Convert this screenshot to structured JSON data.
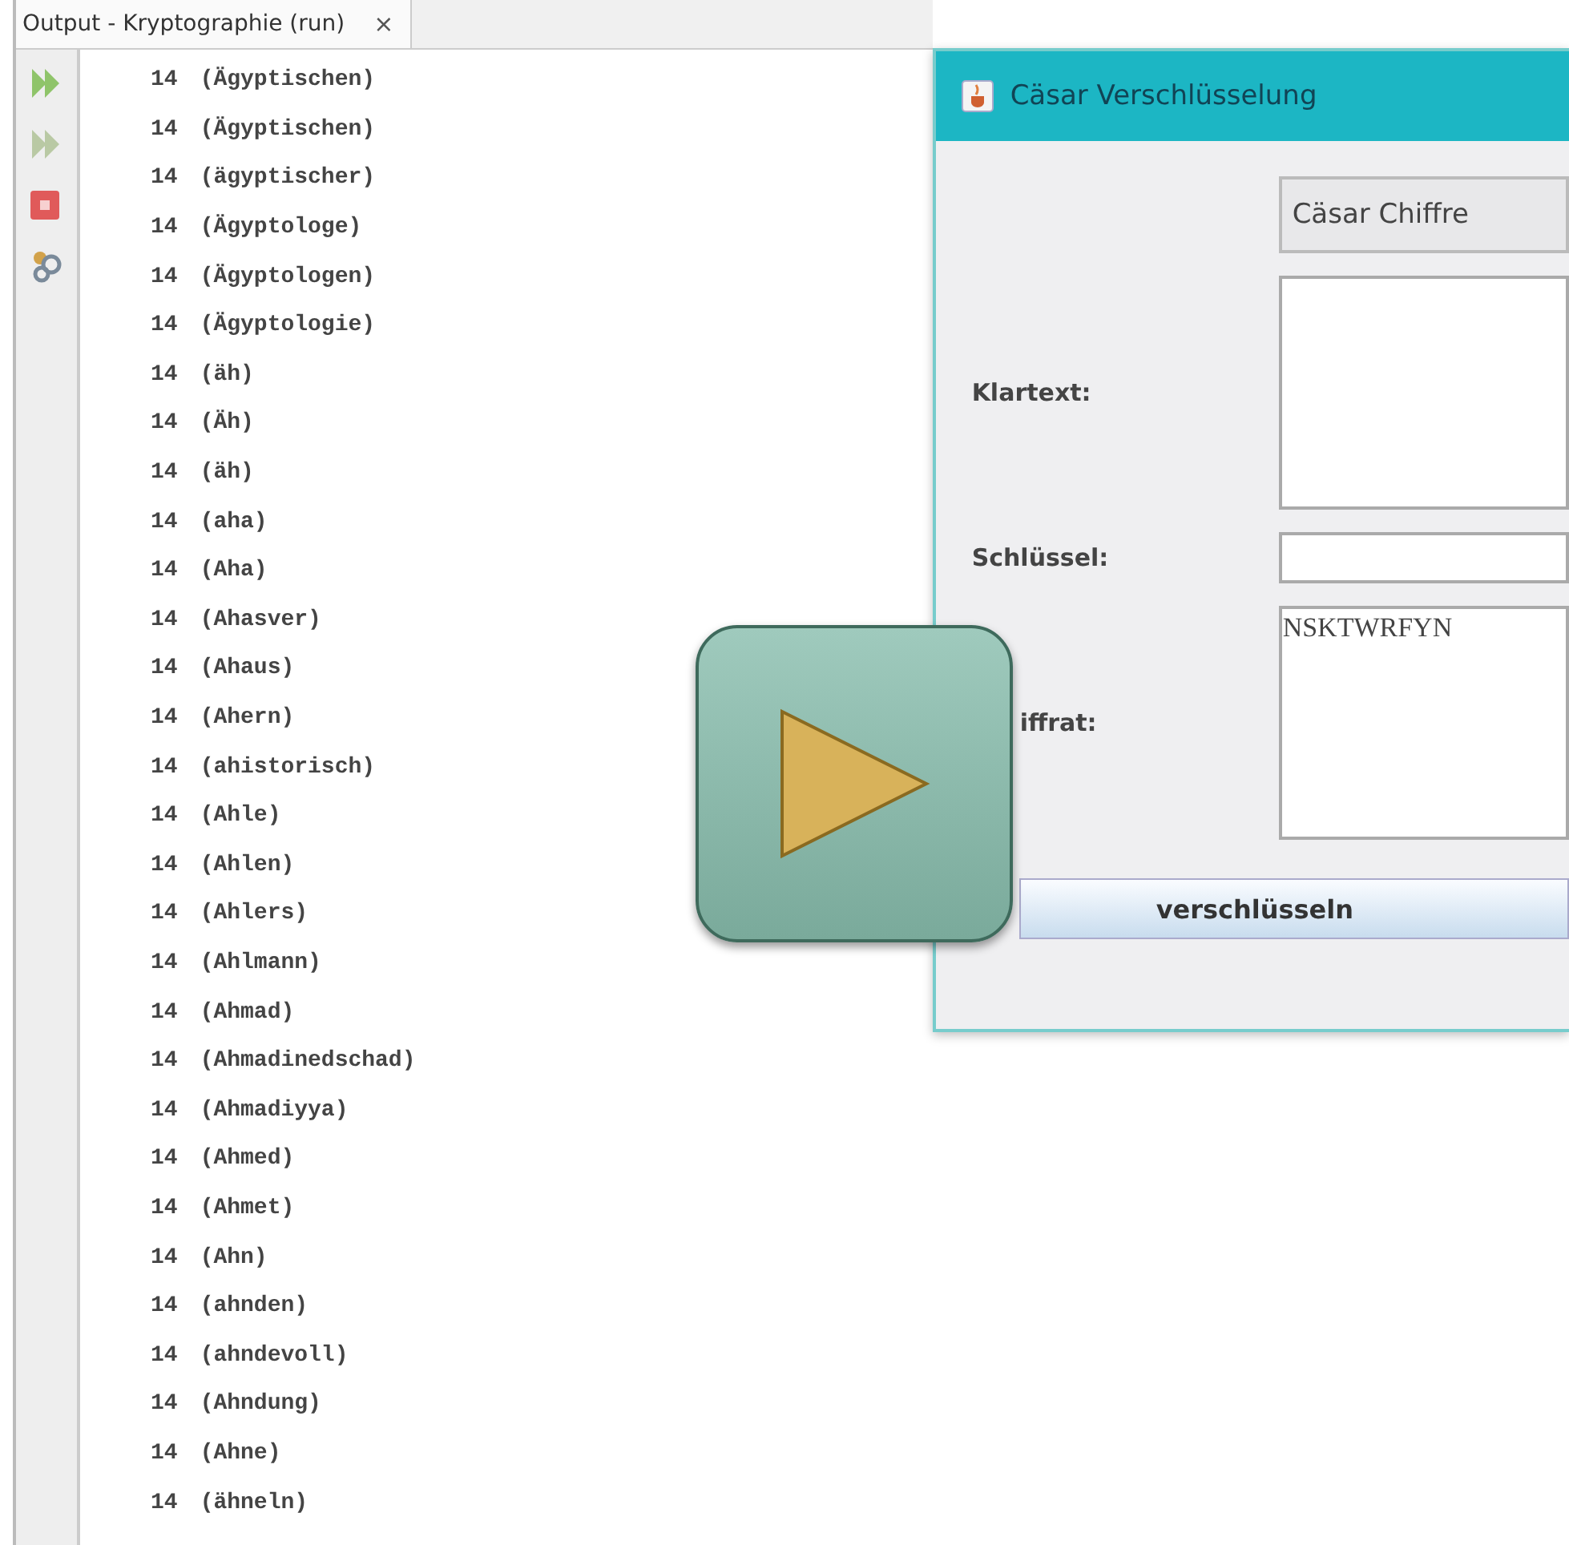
{
  "output_panel": {
    "tab": {
      "title": "Output - Kryptographie (run)",
      "close": "×"
    },
    "lines": [
      {
        "count": "14",
        "word": "(Ägyptischen)"
      },
      {
        "count": "14",
        "word": "(Ägyptischen)"
      },
      {
        "count": "14",
        "word": "(ägyptischer)"
      },
      {
        "count": "14",
        "word": "(Ägyptologe)"
      },
      {
        "count": "14",
        "word": "(Ägyptologen)"
      },
      {
        "count": "14",
        "word": "(Ägyptologie)"
      },
      {
        "count": "14",
        "word": "(äh)"
      },
      {
        "count": "14",
        "word": "(Äh)"
      },
      {
        "count": "14",
        "word": "(äh)"
      },
      {
        "count": "14",
        "word": "(aha)"
      },
      {
        "count": "14",
        "word": "(Aha)"
      },
      {
        "count": "14",
        "word": "(Ahasver)"
      },
      {
        "count": "14",
        "word": "(Ahaus)"
      },
      {
        "count": "14",
        "word": "(Ahern)"
      },
      {
        "count": "14",
        "word": "(ahistorisch)"
      },
      {
        "count": "14",
        "word": "(Ahle)"
      },
      {
        "count": "14",
        "word": "(Ahlen)"
      },
      {
        "count": "14",
        "word": "(Ahlers)"
      },
      {
        "count": "14",
        "word": "(Ahlmann)"
      },
      {
        "count": "14",
        "word": "(Ahmad)"
      },
      {
        "count": "14",
        "word": "(Ahmadinedschad)"
      },
      {
        "count": "14",
        "word": "(Ahmadiyya)"
      },
      {
        "count": "14",
        "word": "(Ahmed)"
      },
      {
        "count": "14",
        "word": "(Ahmet)"
      },
      {
        "count": "14",
        "word": "(Ahn)"
      },
      {
        "count": "14",
        "word": "(ahnden)"
      },
      {
        "count": "14",
        "word": "(ahndevoll)"
      },
      {
        "count": "14",
        "word": "(Ahndung)"
      },
      {
        "count": "14",
        "word": "(Ahne)"
      },
      {
        "count": "14",
        "word": "(ähneln)"
      }
    ]
  },
  "dialog": {
    "title": "Cäsar Verschlüsselung",
    "cipher_select": {
      "value": "Cäsar Chiffre"
    },
    "fields": [
      {
        "kind": "area",
        "label": "Klartext:"
      },
      {
        "kind": "line",
        "label": "Schlüssel:"
      },
      {
        "kind": "area",
        "label": "iffrat:",
        "value": "NSKTWRFYN"
      }
    ],
    "button": "verschlüsseln"
  },
  "video": {
    "play_button": true
  }
}
